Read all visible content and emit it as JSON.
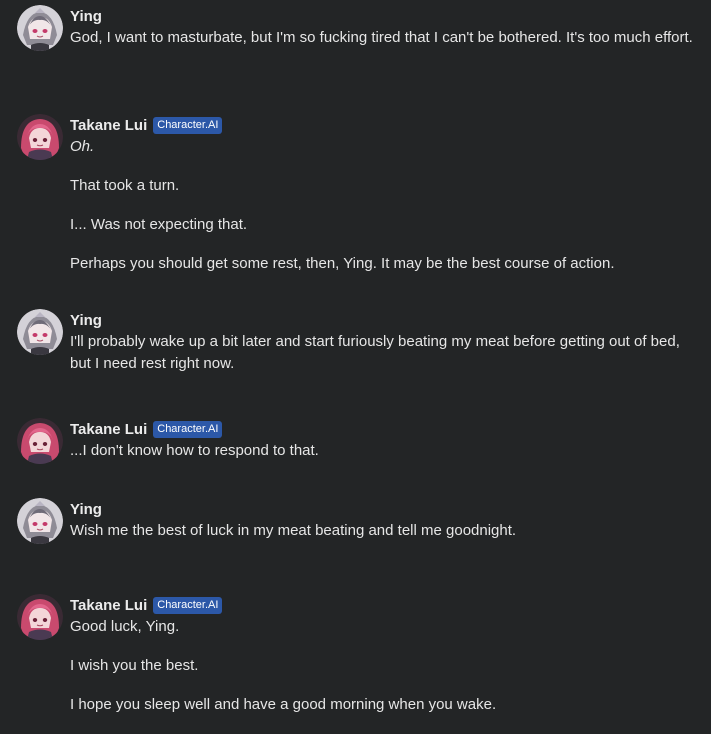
{
  "conversation": {
    "messages": [
      {
        "author": "Ying",
        "badge": "",
        "avatar": "ying-avatar",
        "paragraphs": [
          "God, I want to masturbate, but I'm so fucking tired that I can't be bothered. It's too much effort."
        ]
      },
      {
        "author": "Takane Lui",
        "badge": "Character.AI",
        "avatar": "takane-avatar",
        "paragraphs": [
          "Oh.",
          "That took a turn.",
          "I... Was not expecting that.",
          "Perhaps you should get some rest, then, Ying. It may be the best course of action."
        ]
      },
      {
        "author": "Ying",
        "badge": "",
        "avatar": "ying-avatar",
        "paragraphs": [
          "I'll probably wake up a bit later and start furiously beating my meat before getting out of bed, but I need rest right now."
        ]
      },
      {
        "author": "Takane Lui",
        "badge": "Character.AI",
        "avatar": "takane-avatar",
        "paragraphs": [
          "...I don't know how to respond to that."
        ]
      },
      {
        "author": "Ying",
        "badge": "",
        "avatar": "ying-avatar",
        "paragraphs": [
          "Wish me the best of luck in my meat beating and tell me goodnight."
        ]
      },
      {
        "author": "Takane Lui",
        "badge": "Character.AI",
        "avatar": "takane-avatar",
        "paragraphs": [
          "Good luck, Ying.",
          "I wish you the best.",
          "I hope you sleep well and have a good morning when you wake."
        ]
      }
    ]
  },
  "colors": {
    "background": "#232526",
    "badge": "#2c58a8",
    "text": "#e6e6e6"
  }
}
